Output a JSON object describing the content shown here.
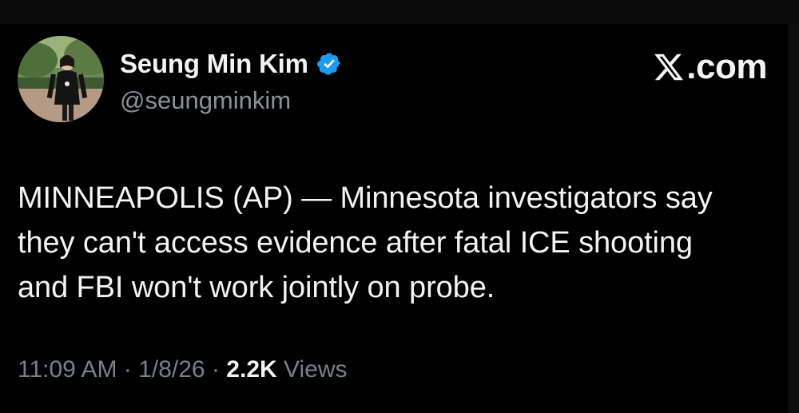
{
  "author": {
    "display_name": "Seung Min Kim",
    "handle": "@seungminkim",
    "verified_icon": "verified-badge-icon",
    "verified_color": "#1d9bf0",
    "avatar": "profile-photo"
  },
  "brand": {
    "label": ".com",
    "logo": "x-logo-icon"
  },
  "tweet": {
    "lines": [
      "MINNEAPOLIS (AP) — Minnesota investigators say",
      "they can't access evidence after fatal ICE shooting",
      "and FBI won't work jointly on probe."
    ]
  },
  "meta": {
    "time": "11:09 AM",
    "separator": " · ",
    "date": "1/8/26",
    "views_count": "2.2K",
    "views_label": " Views"
  },
  "colors": {
    "background": "#000000",
    "text_primary": "#f2f3f4",
    "text_secondary": "#7a8087"
  }
}
